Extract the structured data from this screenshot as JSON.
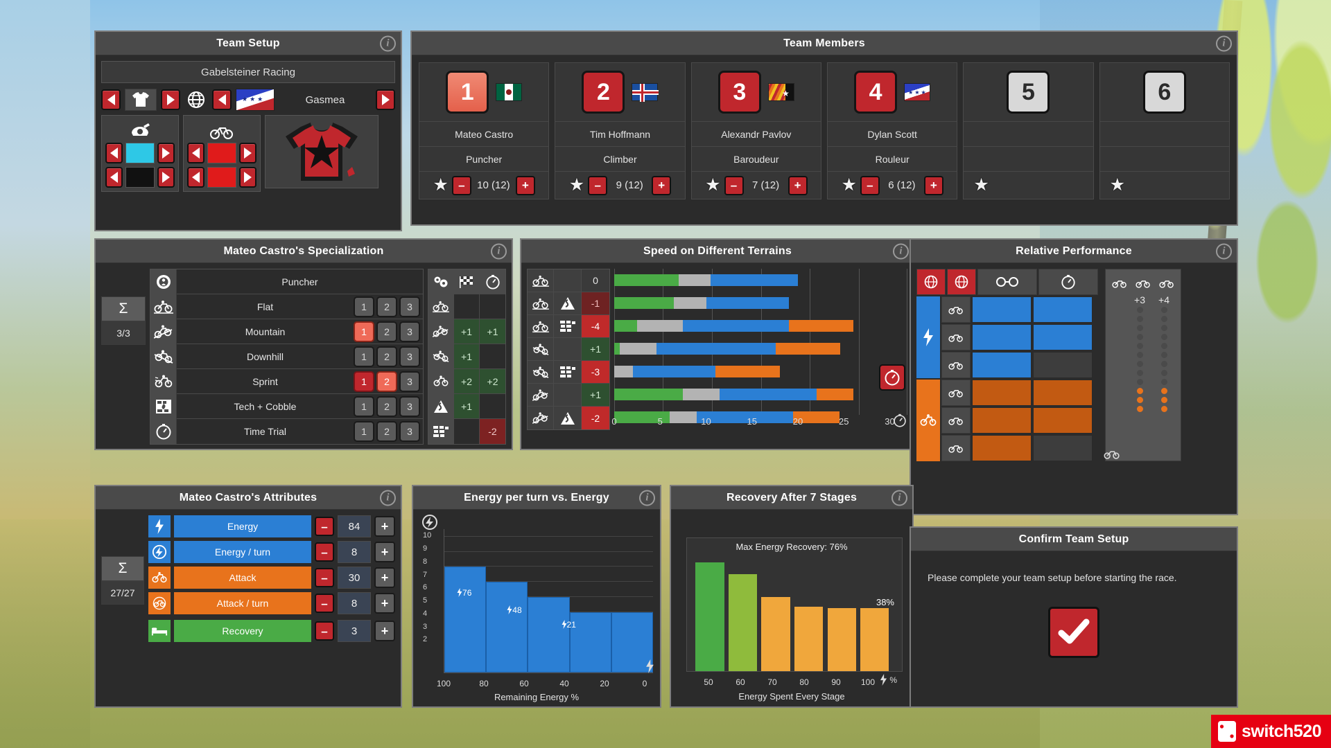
{
  "team_setup": {
    "title": "Team Setup",
    "team_name": "Gabelsteiner Racing",
    "nation_label": "Gasmea",
    "icons": {
      "jersey": "jersey-icon",
      "globe": "globe-icon",
      "helmet": "helmet-icon",
      "bike": "bike-icon"
    },
    "colors": {
      "primary": "#2ec8e6",
      "secondary": "#111111",
      "tertiary": "#e01b1b",
      "quaternary": "#e01b1b"
    }
  },
  "team_members": {
    "title": "Team Members",
    "members": [
      {
        "number": "1",
        "name": "Mateo Castro",
        "role": "Puncher",
        "rating": "10 (12)",
        "state": "selected",
        "flag": "mexico-flag"
      },
      {
        "number": "2",
        "name": "Tim Hoffmann",
        "role": "Climber",
        "rating": "9 (12)",
        "state": "filled",
        "flag": "iceland-flag"
      },
      {
        "number": "3",
        "name": "Alexandr Pavlov",
        "role": "Baroudeur",
        "rating": "7 (12)",
        "state": "filled",
        "flag": "rhodia-flag"
      },
      {
        "number": "4",
        "name": "Dylan Scott",
        "role": "Rouleur",
        "rating": "6 (12)",
        "state": "filled",
        "flag": "equatoria-flag"
      },
      {
        "number": "5",
        "name": "",
        "role": "",
        "rating": "",
        "state": "empty",
        "flag": ""
      },
      {
        "number": "6",
        "name": "",
        "role": "",
        "rating": "",
        "state": "empty",
        "flag": ""
      }
    ]
  },
  "specialization": {
    "title": "Mateo Castro's Specialization",
    "sigma_symbol": "Σ",
    "sigma_value": "3/3",
    "class_name": "Puncher",
    "class_icon": "class-gear-icon",
    "rows": [
      {
        "icon": "flat-bike-icon",
        "label": "Flat",
        "levels": [
          "1",
          "2",
          "3"
        ],
        "active": 0
      },
      {
        "icon": "mountain-bike-icon",
        "label": "Mountain",
        "levels": [
          "1",
          "2",
          "3"
        ],
        "active": 1
      },
      {
        "icon": "downhill-bike-icon",
        "label": "Downhill",
        "levels": [
          "1",
          "2",
          "3"
        ],
        "active": 0
      },
      {
        "icon": "sprint-bike-icon",
        "label": "Sprint",
        "levels": [
          "1",
          "2",
          "3"
        ],
        "active": 2
      },
      {
        "icon": "cobble-icon",
        "label": "Tech + Cobble",
        "levels": [
          "1",
          "2",
          "3"
        ],
        "active": 0
      },
      {
        "icon": "stopwatch-icon",
        "label": "Time Trial",
        "levels": [
          "1",
          "2",
          "3"
        ],
        "active": 0
      }
    ],
    "bonus_headers": [
      "gears-icon",
      "checkered-flag-icon",
      "stopwatch-icon"
    ],
    "bonus_rows": [
      {
        "icon": "flat-bike-icon",
        "values": [
          "",
          ""
        ]
      },
      {
        "icon": "mountain-bike-icon",
        "values": [
          "+1",
          "+1"
        ]
      },
      {
        "icon": "downhill-bike-icon",
        "values": [
          "+1",
          ""
        ]
      },
      {
        "icon": "sprint-bike-icon",
        "values": [
          "+2",
          "+2"
        ]
      },
      {
        "icon": "curve-sign-icon",
        "values": [
          "+1",
          ""
        ]
      },
      {
        "icon": "cobbles-icon",
        "values": [
          "",
          "-2"
        ]
      }
    ]
  },
  "terrains": {
    "title": "Speed on Different Terrains",
    "chart_data": {
      "type": "bar",
      "title": "Speed on Different Terrains",
      "xlabel": "",
      "ylabel": "",
      "xlim": [
        0,
        32
      ],
      "ticks": [
        0,
        5,
        10,
        15,
        20,
        25,
        30
      ],
      "grid": true,
      "legend": [
        "green",
        "grey",
        "blue",
        "orange"
      ],
      "categories": [
        "Flat",
        "Flat + Curve",
        "Flat + Cobbles",
        "Downhill",
        "Downhill + Cobbles",
        "Uphill",
        "Uphill + Curve"
      ],
      "modifiers": [
        "0",
        "-1",
        "-4",
        "+1",
        "-3",
        "+1",
        "-2"
      ],
      "series": [
        {
          "name": "green",
          "values": [
            7.0,
            6.5,
            2.5,
            0.6,
            0.0,
            7.5,
            6.0
          ]
        },
        {
          "name": "grey",
          "values": [
            3.5,
            3.5,
            5.0,
            4.0,
            2.0,
            4.0,
            3.0
          ]
        },
        {
          "name": "blue",
          "values": [
            9.5,
            9.0,
            11.5,
            13.0,
            9.0,
            10.5,
            10.5
          ]
        },
        {
          "name": "orange",
          "values": [
            0.0,
            0.0,
            7.0,
            7.0,
            7.0,
            4.0,
            5.0
          ]
        }
      ]
    },
    "row_icons": [
      {
        "base": "flat-bike-icon",
        "extra": ""
      },
      {
        "base": "flat-bike-icon",
        "extra": "curve-sign-icon"
      },
      {
        "base": "flat-bike-icon",
        "extra": "cobbles-icon"
      },
      {
        "base": "downhill-bike-icon",
        "extra": ""
      },
      {
        "base": "downhill-bike-icon",
        "extra": "cobbles-icon"
      },
      {
        "base": "uphill-bike-icon",
        "extra": ""
      },
      {
        "base": "uphill-bike-icon",
        "extra": "curve-sign-icon"
      }
    ],
    "axis_icon": "stopwatch-icon",
    "badge_icon": "stopwatch-badge-icon"
  },
  "relative_performance": {
    "title": "Relative Performance",
    "header_icons": [
      "globe-red-icon",
      "globe-red-icon-2",
      "glasses-icon",
      "stopwatch-icon"
    ],
    "right_headers": [
      "bike-icon-a",
      "bike-icon-b",
      "bike-icon-c"
    ],
    "right_values": [
      "+3",
      "+4"
    ],
    "row_icons": [
      "bike-icon-1",
      "bike-icon-2",
      "stopwatch-icon",
      "bike-icon-3",
      "bike-icon-4",
      "bike-icon-5",
      "stopwatch-icon"
    ],
    "side_icons": [
      "energy-bolt-icon",
      "attack-rider-icon"
    ],
    "bottom_icon": "bike-icon-small"
  },
  "attributes": {
    "title": "Mateo Castro's Attributes",
    "sigma_symbol": "Σ",
    "sigma_value": "27/27",
    "rows": [
      {
        "icon": "bolt-icon",
        "label": "Energy",
        "value": "84",
        "color": "#2b7fd4"
      },
      {
        "icon": "bolt-turn-icon",
        "label": "Energy / turn",
        "value": "8",
        "color": "#2b7fd4"
      },
      {
        "icon": "attack-icon",
        "label": "Attack",
        "value": "30",
        "color": "#e8731c"
      },
      {
        "icon": "attack-turn-icon",
        "label": "Attack / turn",
        "value": "8",
        "color": "#e8731c"
      },
      {
        "icon": "bed-icon",
        "label": "Recovery",
        "value": "3",
        "color": "#4aab46"
      }
    ],
    "minus_label": "–",
    "plus_label": "+"
  },
  "energy_chart": {
    "title": "Energy per turn vs. Energy",
    "chart_data": {
      "type": "bar",
      "title": "Energy per turn vs. Energy",
      "xlabel": "Remaining Energy %",
      "ylabel": "",
      "yticks": [
        10,
        9,
        8,
        7,
        6,
        5,
        4,
        3,
        2
      ],
      "ylim": [
        1,
        10.5
      ],
      "xticks": [
        "100",
        "80",
        "60",
        "40",
        "20",
        "0"
      ],
      "axis_icon": "bolt-icon",
      "categories": [
        "100-80",
        "80-60",
        "60-40",
        "40-20",
        "20-0"
      ],
      "values": [
        8,
        7,
        6,
        5,
        5
      ],
      "annotations": [
        {
          "text": "76",
          "icon": "bolt-icon"
        },
        {
          "text": "48",
          "icon": "bolt-icon"
        },
        {
          "text": "21",
          "icon": "bolt-icon"
        }
      ]
    }
  },
  "recovery_chart": {
    "title": "Recovery After 7 Stages",
    "chart_data": {
      "type": "bar",
      "title": "Recovery After 7 Stages",
      "xlabel": "Energy Spent Every Stage",
      "max_label": "Max Energy Recovery: 76%",
      "end_label": "38%",
      "unit_icon": "bolt-icon",
      "unit_label": "%",
      "categories": [
        "50",
        "60",
        "70",
        "80",
        "90",
        "100"
      ],
      "values": [
        76,
        68,
        52,
        45,
        44,
        44
      ],
      "colors": [
        "#4aab46",
        "#8fbb3c",
        "#f0a73c",
        "#f0a73c",
        "#f0a73c",
        "#f0a73c"
      ]
    }
  },
  "confirm": {
    "title": "Confirm Team Setup",
    "message": "Please complete your team setup before starting the race.",
    "button_icon": "checkmark-icon"
  },
  "watermark": {
    "text": "switch520",
    "logo": "switch-logo"
  }
}
